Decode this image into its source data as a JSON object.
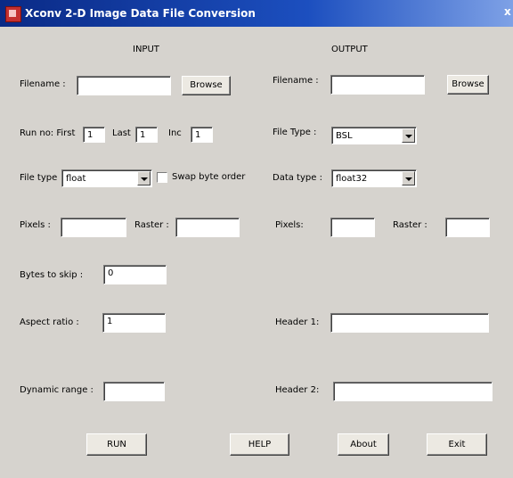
{
  "window": {
    "title": "Xconv 2-D Image Data File Conversion",
    "close_glyph": "x"
  },
  "input": {
    "heading": "INPUT",
    "filename_label": "Filename :",
    "filename_value": "",
    "browse_label": "Browse",
    "run_no_label": "Run no: First",
    "run_first": "1",
    "last_label": "Last",
    "run_last": "1",
    "inc_label": "Inc",
    "run_inc": "1",
    "file_type_label": "File type",
    "file_type_value": "float",
    "swap_label": "Swap byte order",
    "swap_checked": false,
    "pixels_label": "Pixels :",
    "pixels_value": "",
    "raster_label": "Raster :",
    "raster_value": "",
    "bytes_label": "Bytes to skip :",
    "bytes_value": "0",
    "aspect_label": "Aspect ratio :",
    "aspect_value": "1",
    "dynamic_label": "Dynamic range :",
    "dynamic_value": ""
  },
  "output": {
    "heading": "OUTPUT",
    "filename_label": "Filename :",
    "filename_value": "",
    "browse_label": "Browse",
    "file_type_label": "File Type :",
    "file_type_value": "BSL",
    "data_type_label": "Data type :",
    "data_type_value": "float32",
    "pixels_label": "Pixels:",
    "pixels_value": "",
    "raster_label": "Raster :",
    "raster_value": "",
    "header1_label": "Header 1:",
    "header1_value": "",
    "header2_label": "Header 2:",
    "header2_value": ""
  },
  "buttons": {
    "run": "RUN",
    "help": "HELP",
    "about": "About",
    "exit": "Exit"
  },
  "colors": {
    "title_start": "#0a2a86",
    "title_end": "#7ea1e6",
    "window_bg": "#d6d3ce"
  }
}
